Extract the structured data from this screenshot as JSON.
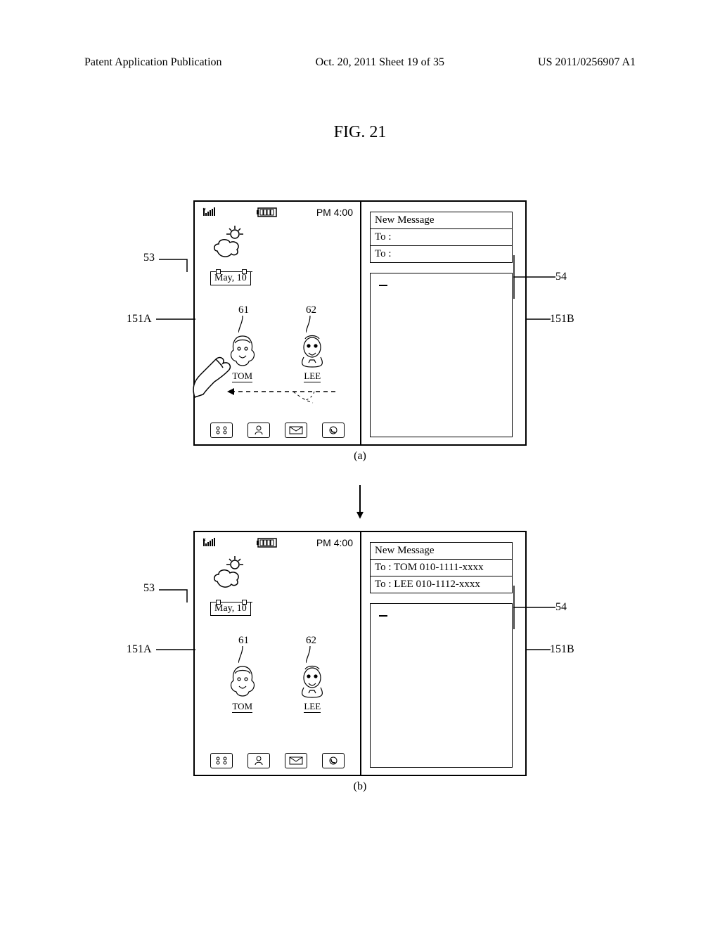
{
  "header": {
    "left": "Patent Application Publication",
    "mid": "Oct. 20, 2011  Sheet 19 of 35",
    "right": "US 2011/0256907 A1"
  },
  "figure_title": "FIG. 21",
  "status": {
    "time": "PM 4:00"
  },
  "weather_date": "May, 10",
  "contacts": {
    "tom": "TOM",
    "lee": "LEE"
  },
  "message": {
    "title": "New Message",
    "to_blank": "To :",
    "to_tom": "To : TOM 010-1111-xxxx",
    "to_lee": "To : LEE 010-1112-xxxx"
  },
  "labels": {
    "l53": "53",
    "l151A": "151A",
    "l54": "54",
    "l151B": "151B",
    "l61": "61",
    "l62": "62"
  },
  "sublabels": {
    "a": "(a)",
    "b": "(b)"
  }
}
